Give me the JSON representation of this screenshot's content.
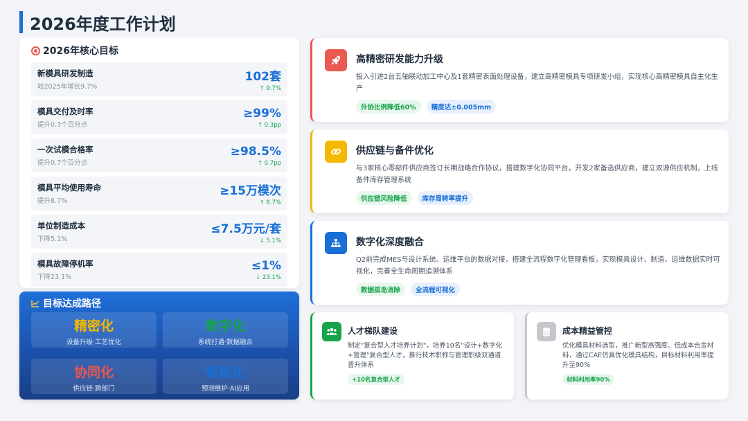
{
  "page": {
    "title": "2026年度工作计划"
  },
  "goals": {
    "header": "2026年核心目标",
    "items": [
      {
        "name": "新模具研发制造",
        "sub": "较2025年增长9.7%",
        "value": "102套",
        "change": "↑ 9.7%"
      },
      {
        "name": "模具交付及时率",
        "sub": "提升0.3个百分点",
        "value": "≥99%",
        "change": "↑ 0.3pp"
      },
      {
        "name": "一次试模合格率",
        "sub": "提升0.7个百分点",
        "value": "≥98.5%",
        "change": "↑ 0.7pp"
      },
      {
        "name": "模具平均使用寿命",
        "sub": "提升8.7%",
        "value": "≥15万模次",
        "change": "↑ 8.7%"
      },
      {
        "name": "单位制造成本",
        "sub": "下降5.1%",
        "value": "≤7.5万元/套",
        "change": "↓ 5.1%"
      },
      {
        "name": "模具故障停机率",
        "sub": "下降23.1%",
        "value": "≤1%",
        "change": "↓ 23.1%"
      }
    ]
  },
  "path": {
    "header": "目标达成路径",
    "tiles": [
      {
        "title": "精密化",
        "sub": "设备升级·工艺优化",
        "color": "#f5b800"
      },
      {
        "title": "数字化",
        "sub": "系统打通·数据融合",
        "color": "#16a34a"
      },
      {
        "title": "协同化",
        "sub": "供应链·跨部门",
        "color": "#e8574f"
      },
      {
        "title": "智能化",
        "sub": "预测维护·AI应用",
        "color": "#1a6fd6"
      }
    ]
  },
  "cards": [
    {
      "title": "高精密研发能力升级",
      "desc": "投入引进2台五轴联动加工中心及1套精密表面处理设备，建立高精密模具专项研发小组，实现核心高精密模具自主化生产",
      "tags": [
        "外协比例降低60%",
        "精度达±0.005mm"
      ],
      "icon": "rocket-icon",
      "color": "#e8574f"
    },
    {
      "title": "供应链与备件优化",
      "desc": "与3家核心零部件供应商签订长期战略合作协议，搭建数字化协同平台，开发2家备选供应商，建立双源供应机制，上线备件库存管理系统",
      "tags": [
        "供应链风险降低",
        "库存周转率提升"
      ],
      "icon": "link-icon",
      "color": "#f2b705"
    },
    {
      "title": "数字化深度融合",
      "desc": "Q2前完成MES与设计系统、运维平台的数据对接，搭建全流程数字化管理看板，实现模具设计、制造、运维数据实时可视化，完善全生命周期追溯体系",
      "tags": [
        "数据孤岛消除",
        "全流程可视化"
      ],
      "icon": "network-icon",
      "color": "#1a6fd6"
    }
  ],
  "small_cards": [
    {
      "title": "人才梯队建设",
      "desc": "制定\"复合型人才培养计划\"，培养10名\"设计+数字化+管理\"复合型人才，推行技术职称与管理职级双通道晋升体系",
      "tag": "+10名复合型人才",
      "icon": "team-icon",
      "color": "#16a34a"
    },
    {
      "title": "成本精益管控",
      "desc": "优化模具材料选型，推广新型高强度、低成本合金材料，通过CAE仿真优化模具结构，目标材料利用率提升至90%",
      "tag": "材料利用率90%",
      "icon": "coins-icon",
      "color": "#bfc3c8"
    }
  ]
}
